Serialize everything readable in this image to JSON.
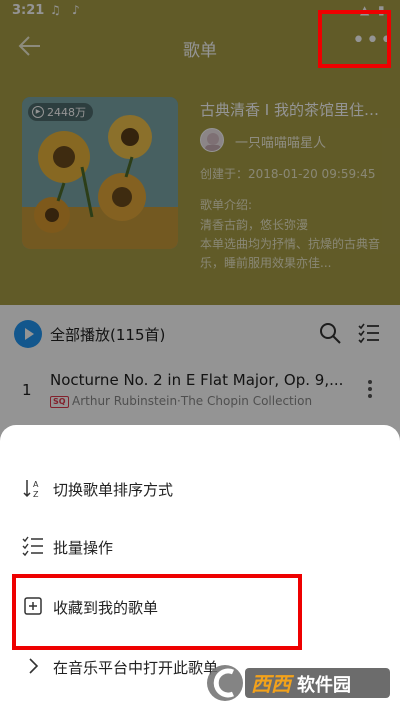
{
  "status_bar": {
    "time": "3:21"
  },
  "nav": {
    "title": "歌单"
  },
  "playlist": {
    "play_count": "2448万",
    "title": "古典清香 I 我的茶馆里住着...",
    "creator": "一只喵喵喵星人",
    "created_at": "创建于：2018-01-20 09:59:45",
    "intro_label": "歌单介绍:",
    "intro_line1": "清香古韵，悠长弥漫",
    "intro_line2": "本单选曲均为抒情、抗燥的古典音乐，睡前服用效果亦佳..."
  },
  "list": {
    "play_all": "全部播放(115首)",
    "songs": [
      {
        "index": "1",
        "title": "Nocturne No. 2 in E Flat Major, Op. 9,...",
        "badge": "SQ",
        "artist": "Arthur Rubinstein·The Chopin Collection: ..."
      }
    ]
  },
  "sheet": {
    "items": [
      {
        "label": "切换歌单排序方式",
        "icon": "sort-az-icon"
      },
      {
        "label": "批量操作",
        "icon": "checklist-icon"
      },
      {
        "label": "收藏到我的歌单",
        "icon": "add-box-icon"
      },
      {
        "label": "在音乐平台中打开此歌单",
        "icon": "chevron-right-icon"
      }
    ]
  },
  "watermark": {
    "logo_text": "西西软件园",
    "sub_text": "CR173.com"
  },
  "colors": {
    "header_bg": "#a79d46",
    "accent": "#2196f3",
    "highlight": "#ee0000",
    "sq": "#e0394d"
  }
}
